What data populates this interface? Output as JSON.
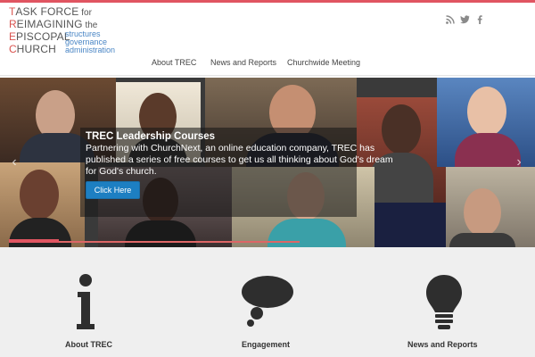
{
  "logo": {
    "line1_cap": "T",
    "line1_rest": "ASK FORCE",
    "line1_small": " for",
    "line2_cap": "R",
    "line2_rest": "EIMAGINING",
    "line2_small": " the",
    "line3_cap": "E",
    "line3_rest": "PISCOPAL",
    "line4_cap": "C",
    "line4_rest": "HURCH",
    "sub1": "structures",
    "sub2": "governance",
    "sub3": "administration"
  },
  "social": {
    "rss": "rss-icon",
    "twitter": "twitter-icon",
    "facebook": "facebook-icon"
  },
  "nav": {
    "items": [
      {
        "label": "About TREC"
      },
      {
        "label": "News and Reports"
      },
      {
        "label": "Churchwide Meeting"
      }
    ]
  },
  "slider": {
    "title": "TREC Leadership Courses",
    "text": "Partnering with ChurchNext, an online education company, TREC has published a series of free courses to get us all thinking about God's dream for God's church.",
    "button": "Click Here",
    "prev": "‹",
    "next": "›"
  },
  "features": [
    {
      "label": "About TREC",
      "icon": "info-icon"
    },
    {
      "label": "Engagement",
      "icon": "speech-bubble-icon"
    },
    {
      "label": "News and Reports",
      "icon": "lightbulb-icon"
    }
  ],
  "colors": {
    "accent": "#e05561",
    "logo_blue": "#4a86c5",
    "button_blue": "#1d7fc2"
  }
}
